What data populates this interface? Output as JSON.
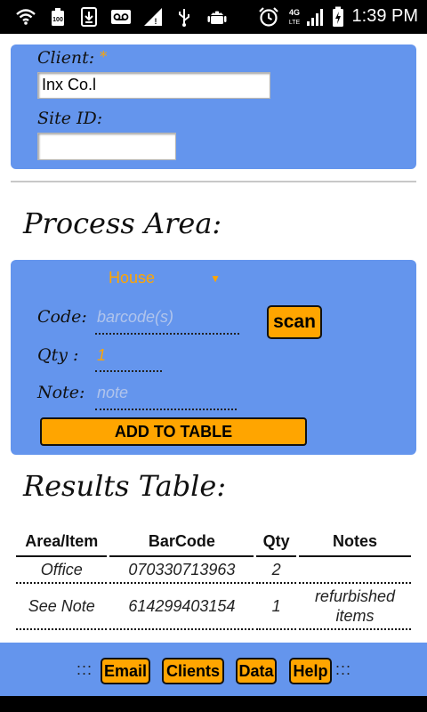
{
  "status_bar": {
    "time": "1:39 PM",
    "icons": [
      "wifi-icon",
      "battery-100-icon",
      "download-icon",
      "voicemail-icon",
      "wifi-alert-icon",
      "usb-icon",
      "android-icon",
      "alarm-icon",
      "4g-lte-icon",
      "signal-icon",
      "battery-charging-icon"
    ],
    "network_label": "4G"
  },
  "client_panel": {
    "client_label": "Client:",
    "required_mark": "*",
    "client_value": "Inx Co.l",
    "site_label": "Site ID:",
    "site_value": ""
  },
  "process": {
    "heading": "Process Area:",
    "area_selected": "House",
    "code_label": "Code:",
    "code_placeholder": "barcode(s)",
    "scan_label": "scan",
    "qty_label": "Qty :",
    "qty_value": "1",
    "note_label": "Note:",
    "note_placeholder": "note",
    "add_button": "ADD TO TABLE"
  },
  "results": {
    "heading": "Results Table:",
    "columns": [
      "Area/Item",
      "BarCode",
      "Qty",
      "Notes"
    ],
    "rows": [
      {
        "area": "Office",
        "barcode": "070330713963",
        "qty": "2",
        "notes": ""
      },
      {
        "area": "See Note",
        "barcode": "614299403154",
        "qty": "1",
        "notes": "refurbished items"
      }
    ]
  },
  "footer": {
    "left_sep": ":::",
    "right_sep": ":::",
    "buttons": [
      "Email",
      "Clients",
      "Data",
      "Help"
    ]
  },
  "colors": {
    "panel": "#6495ed",
    "accent": "#ffa500"
  }
}
